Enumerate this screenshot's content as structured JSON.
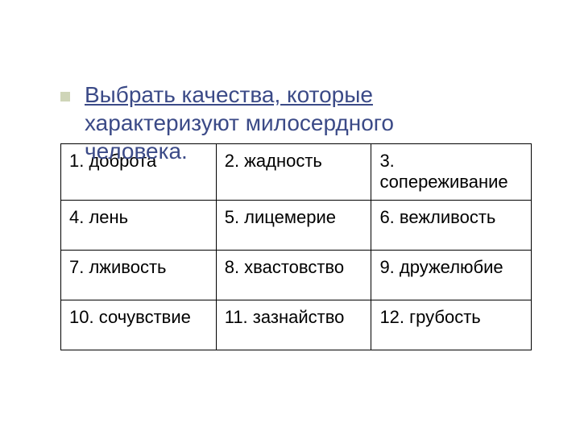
{
  "title_line1": "Выбрать качества, которые",
  "title_line2": "характеризуют милосердного",
  "title_line3": "человека.",
  "cells": {
    "r0c0": "1. доброта",
    "r0c1": "2. жадность",
    "r0c2": "3. сопереживание",
    "r1c0": "4. лень",
    "r1c1": "5. лицемерие",
    "r1c2": "6. вежливость",
    "r2c0": "7. лживость",
    "r2c1": "8. хвастовство",
    "r2c2": "9. дружелюбие",
    "r3c0": "10. сочувствие",
    "r3c1": "11. зазнайство",
    "r3c2": "12. грубость"
  }
}
